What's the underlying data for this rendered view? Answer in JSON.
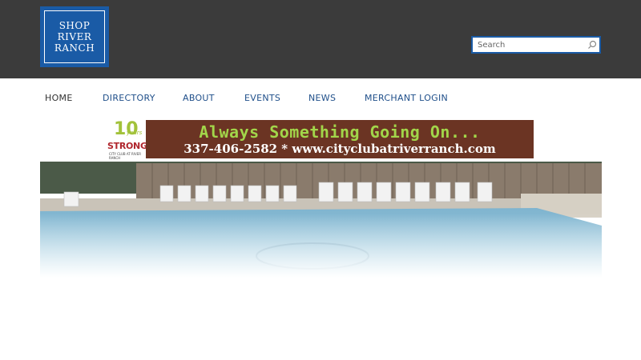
{
  "logo": {
    "line1": "SHOP",
    "line2": "RIVER",
    "line3": "RANCH"
  },
  "search": {
    "placeholder": "Search",
    "icon": "search-icon"
  },
  "nav": {
    "items": [
      {
        "label": "HOME"
      },
      {
        "label": "DIRECTORY"
      },
      {
        "label": "ABOUT"
      },
      {
        "label": "EVENTS"
      },
      {
        "label": "NEWS"
      },
      {
        "label": "MERCHANT LOGIN"
      }
    ]
  },
  "banner": {
    "badge_number": "10",
    "badge_years": "years",
    "badge_strong": "STRONG",
    "badge_small": "CITY CLUB AT RIVER RANCH",
    "headline": "Always Something Going On...",
    "contact": "337-406-2582 * www.cityclubatriverranch.com"
  },
  "colors": {
    "header_bg": "#3b3b3b",
    "brand_blue": "#1a5ba6",
    "nav_link": "#1f4f8a",
    "banner_bg": "#6b3423",
    "banner_green": "#a2d64a",
    "strong_red": "#b0262d"
  }
}
